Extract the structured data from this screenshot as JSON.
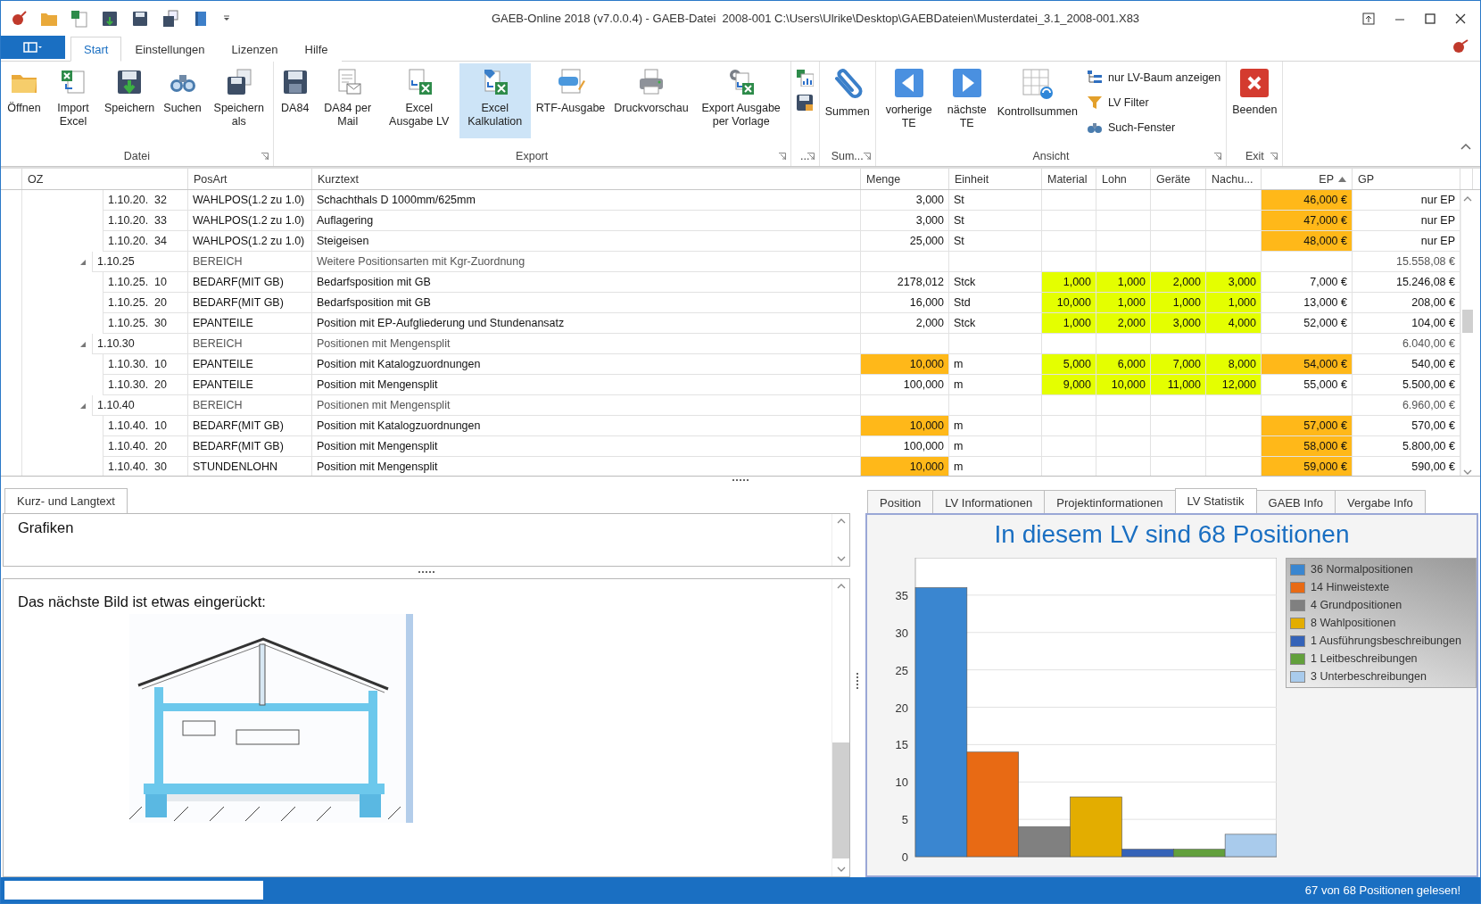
{
  "window": {
    "title": "GAEB-Online 2018 (v7.0.0.4) - GAEB-Datei  2008-001 C:\\Users\\Ulrike\\Desktop\\GAEBDateien\\Musterdatei_3.1_2008-001.X83"
  },
  "ribbon_tabs": [
    {
      "label": "Start",
      "selected": true
    },
    {
      "label": "Einstellungen",
      "selected": false
    },
    {
      "label": "Lizenzen",
      "selected": false
    },
    {
      "label": "Hilfe",
      "selected": false
    }
  ],
  "ribbon_groups": [
    {
      "label": "Datei",
      "buttons": [
        {
          "kind": "large",
          "label": "Öffnen",
          "highlighted": false
        },
        {
          "kind": "large",
          "label": "Import Excel",
          "highlighted": false
        },
        {
          "kind": "large",
          "label": "Speichern",
          "highlighted": false
        },
        {
          "kind": "large",
          "label": "Suchen",
          "highlighted": false
        },
        {
          "kind": "large",
          "label": "Speichern als",
          "highlighted": false
        }
      ]
    },
    {
      "label": "Export",
      "buttons": [
        {
          "kind": "large",
          "label": "DA84",
          "highlighted": false
        },
        {
          "kind": "large",
          "label": "DA84 per Mail",
          "highlighted": false
        },
        {
          "kind": "large",
          "label": "Excel Ausgabe LV",
          "highlighted": false
        },
        {
          "kind": "large",
          "label": "Excel Kalkulation",
          "highlighted": true
        },
        {
          "kind": "large",
          "label": "RTF-Ausgabe",
          "highlighted": false
        },
        {
          "kind": "large",
          "label": "Druckvorschau",
          "highlighted": false
        },
        {
          "kind": "large",
          "label": "Export Ausgabe per Vorlage",
          "highlighted": false
        }
      ]
    },
    {
      "label": "...",
      "buttons": [
        {
          "kind": "icon",
          "highlighted": false
        },
        {
          "kind": "icon",
          "highlighted": false
        }
      ]
    },
    {
      "label": "Sum...",
      "buttons": [
        {
          "kind": "large",
          "label": "Summen",
          "highlighted": false
        }
      ]
    },
    {
      "label": "Ansicht",
      "buttons": [
        {
          "kind": "large",
          "label": "vorherige TE",
          "highlighted": false
        },
        {
          "kind": "large",
          "label": "nächste TE",
          "highlighted": false
        },
        {
          "kind": "large",
          "label": "Kontrollsummen",
          "highlighted": false
        },
        {
          "kind": "small",
          "label": "nur LV-Baum anzeigen",
          "highlighted": false
        },
        {
          "kind": "small",
          "label": "LV Filter",
          "highlighted": false
        },
        {
          "kind": "small",
          "label": "Such-Fenster",
          "highlighted": false
        }
      ]
    },
    {
      "label": "Exit",
      "buttons": [
        {
          "kind": "large",
          "label": "Beenden",
          "highlighted": false
        }
      ]
    }
  ],
  "table": {
    "columns": [
      {
        "label": "OZ",
        "sorted": false
      },
      {
        "label": "PosArt",
        "sorted": false
      },
      {
        "label": "Kurztext",
        "sorted": false
      },
      {
        "label": "Menge",
        "sorted": false
      },
      {
        "label": "Einheit",
        "sorted": false
      },
      {
        "label": "Material",
        "sorted": false
      },
      {
        "label": "Lohn",
        "sorted": false
      },
      {
        "label": "Geräte",
        "sorted": false
      },
      {
        "label": "Nachu...",
        "sorted": false
      },
      {
        "label": "EP",
        "sorted": true
      },
      {
        "label": "GP",
        "sorted": false
      }
    ],
    "rows": [
      {
        "kind": "position",
        "oz": "1.10.20.  32",
        "posart": "WAHLPOS(1.2 zu 1.0)",
        "kurztext": "Schachthals D 1000mm/625mm",
        "menge": "3,000",
        "einheit": "St",
        "ep": "46,000 €",
        "gp": "nur EP",
        "menge_marked": false,
        "ep_marked": true
      },
      {
        "kind": "position",
        "oz": "1.10.20.  33",
        "posart": "WAHLPOS(1.2 zu 1.0)",
        "kurztext": "Auflagering",
        "menge": "3,000",
        "einheit": "St",
        "ep": "47,000 €",
        "gp": "nur EP",
        "menge_marked": false,
        "ep_marked": true
      },
      {
        "kind": "position",
        "oz": "1.10.20.  34",
        "posart": "WAHLPOS(1.2 zu 1.0)",
        "kurztext": "Steigeisen",
        "menge": "25,000",
        "einheit": "St",
        "ep": "48,000 €",
        "gp": "nur EP",
        "menge_marked": false,
        "ep_marked": true
      },
      {
        "kind": "group",
        "oz": "1.10.25",
        "posart": "BEREICH",
        "kurztext": "Weitere Positionsarten mit Kgr-Zuordnung",
        "gp": "15.558,08 €",
        "expanded": true,
        "children": [
          {
            "kind": "position",
            "oz": "1.10.25.  10",
            "posart": "BEDARF(MIT GB)",
            "kurztext": "Bedarfsposition mit GB",
            "menge": "2178,012",
            "einheit": "Stck",
            "material": "1,000",
            "lohn": "1,000",
            "geraete": "2,000",
            "nachu": "3,000",
            "ep": "7,000 €",
            "gp": "15.246,08 €",
            "menge_marked": false,
            "ep_marked": false
          },
          {
            "kind": "position",
            "oz": "1.10.25.  20",
            "posart": "BEDARF(MIT GB)",
            "kurztext": "Bedarfsposition mit GB",
            "menge": "16,000",
            "einheit": "Std",
            "material": "10,000",
            "lohn": "1,000",
            "geraete": "1,000",
            "nachu": "1,000",
            "ep": "13,000 €",
            "gp": "208,00 €",
            "menge_marked": false,
            "ep_marked": false
          },
          {
            "kind": "position",
            "oz": "1.10.25.  30",
            "posart": "EPANTEILE",
            "kurztext": "Position mit EP-Aufgliederung und Stundenansatz",
            "menge": "2,000",
            "einheit": "Stck",
            "material": "1,000",
            "lohn": "2,000",
            "geraete": "3,000",
            "nachu": "4,000",
            "ep": "52,000 €",
            "gp": "104,00 €",
            "menge_marked": false,
            "ep_marked": false
          }
        ]
      },
      {
        "kind": "group",
        "oz": "1.10.30",
        "posart": "BEREICH",
        "kurztext": "Positionen mit Mengensplit",
        "gp": "6.040,00 €",
        "expanded": true,
        "children": [
          {
            "kind": "position",
            "oz": "1.10.30.  10",
            "posart": "EPANTEILE",
            "kurztext": "Position mit Katalogzuordnungen",
            "menge": "10,000",
            "einheit": "m",
            "material": "5,000",
            "lohn": "6,000",
            "geraete": "7,000",
            "nachu": "8,000",
            "ep": "54,000 €",
            "gp": "540,00 €",
            "menge_marked": true,
            "ep_marked": true
          },
          {
            "kind": "position",
            "oz": "1.10.30.  20",
            "posart": "EPANTEILE",
            "kurztext": "Position mit Mengensplit",
            "menge": "100,000",
            "einheit": "m",
            "material": "9,000",
            "lohn": "10,000",
            "geraete": "11,000",
            "nachu": "12,000",
            "ep": "55,000 €",
            "gp": "5.500,00 €",
            "menge_marked": false,
            "ep_marked": false
          }
        ]
      },
      {
        "kind": "group",
        "oz": "1.10.40",
        "posart": "BEREICH",
        "kurztext": "Positionen mit Mengensplit",
        "gp": "6.960,00 €",
        "expanded": true,
        "children": [
          {
            "kind": "position",
            "oz": "1.10.40.  10",
            "posart": "BEDARF(MIT GB)",
            "kurztext": "Position mit Katalogzuordnungen",
            "menge": "10,000",
            "einheit": "m",
            "ep": "57,000 €",
            "gp": "570,00 €",
            "menge_marked": true,
            "ep_marked": true
          },
          {
            "kind": "position",
            "oz": "1.10.40.  20",
            "posart": "BEDARF(MIT GB)",
            "kurztext": "Position mit Mengensplit",
            "menge": "100,000",
            "einheit": "m",
            "ep": "58,000 €",
            "gp": "5.800,00 €",
            "menge_marked": false,
            "ep_marked": true
          },
          {
            "kind": "position",
            "oz": "1.10.40.  30",
            "posart": "STUNDENLOHN",
            "kurztext": "Position mit Mengensplit",
            "menge": "10,000",
            "einheit": "m",
            "ep": "59,000 €",
            "gp": "590,00 €",
            "menge_marked": true,
            "ep_marked": true
          }
        ]
      }
    ]
  },
  "text_panel": {
    "tabs": [
      {
        "label": "Kurz- und Langtext",
        "selected": true
      }
    ],
    "short_text": "Grafiken",
    "long_text": "Das nächste Bild ist etwas eingerückt:"
  },
  "info_panel": {
    "tabs": [
      {
        "label": "Position",
        "selected": false
      },
      {
        "label": "LV Informationen",
        "selected": false
      },
      {
        "label": "Projektinformationen",
        "selected": false
      },
      {
        "label": "LV Statistik",
        "selected": true
      },
      {
        "label": "GAEB Info",
        "selected": false
      },
      {
        "label": "Vergabe Info",
        "selected": false
      }
    ],
    "chart_data": {
      "type": "bar",
      "grid": true,
      "title": "In diesem LV sind 68 Positionen",
      "ylim": [
        0,
        40
      ],
      "yticks": [
        0,
        5,
        10,
        15,
        20,
        25,
        30,
        35
      ],
      "series": [
        {
          "name": "36 Normalpositionen",
          "color": "#3a86d0",
          "values": [
            36
          ]
        },
        {
          "name": "14 Hinweistexte",
          "color": "#e86a14",
          "values": [
            14
          ]
        },
        {
          "name": "4 Grundpositionen",
          "color": "#808080",
          "values": [
            4
          ]
        },
        {
          "name": "8 Wahlpositionen",
          "color": "#e3ad00",
          "values": [
            8
          ]
        },
        {
          "name": "1 Ausführungsbeschreibungen",
          "color": "#3563b8",
          "values": [
            1
          ]
        },
        {
          "name": "1 Leitbeschreibungen",
          "color": "#62a03c",
          "values": [
            1
          ]
        },
        {
          "name": "3 Unterbeschreibungen",
          "color": "#a9cbec",
          "values": [
            3
          ]
        }
      ]
    }
  },
  "status_bar": {
    "message": "67 von 68 Positionen gelesen!"
  }
}
